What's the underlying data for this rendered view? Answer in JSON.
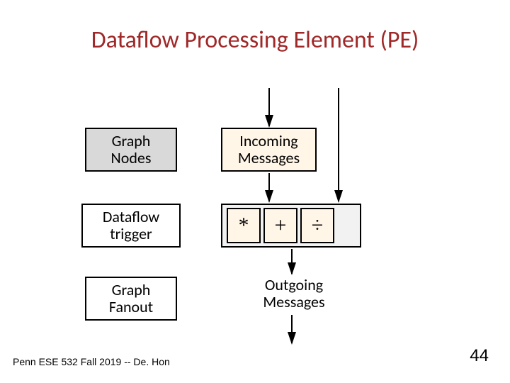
{
  "title": "Dataflow Processing Element (PE)",
  "boxes": {
    "graph_nodes": "Graph\nNodes",
    "incoming": "Incoming\nMessages",
    "dataflow_trigger": "Dataflow\ntrigger",
    "graph_fanout": "Graph\nFanout",
    "outgoing": "Outgoing\nMessages"
  },
  "ops": [
    "*",
    "+",
    "÷"
  ],
  "footer": "Penn ESE 532 Fall 2019 -- De. Hon",
  "page_number": "44",
  "chart_data": {
    "type": "diagram",
    "title": "Dataflow Processing Element (PE)",
    "nodes": [
      {
        "id": "graph_nodes",
        "label": "Graph Nodes"
      },
      {
        "id": "incoming",
        "label": "Incoming Messages"
      },
      {
        "id": "dataflow_trigger",
        "label": "Dataflow trigger"
      },
      {
        "id": "ops",
        "label": "* + ÷",
        "children": [
          "*",
          "+",
          "÷"
        ]
      },
      {
        "id": "graph_fanout",
        "label": "Graph Fanout"
      },
      {
        "id": "outgoing",
        "label": "Outgoing Messages"
      }
    ],
    "edges": [
      {
        "from": "external_top",
        "to": "incoming"
      },
      {
        "from": "incoming",
        "to": "ops"
      },
      {
        "from": "external_top_right",
        "to": "ops"
      },
      {
        "from": "ops",
        "to": "outgoing"
      },
      {
        "from": "outgoing",
        "to": "external_bottom"
      }
    ]
  }
}
